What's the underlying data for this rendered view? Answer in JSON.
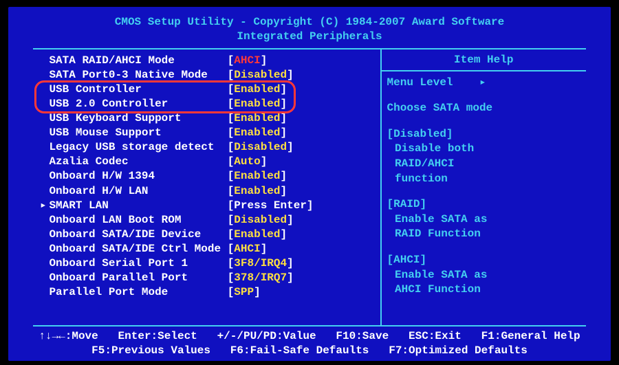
{
  "header": {
    "line1": "CMOS Setup Utility - Copyright (C) 1984-2007 Award Software",
    "line2": "Integrated Peripherals"
  },
  "labelWidth": 27,
  "settings": [
    {
      "label": "SATA RAID/AHCI Mode",
      "value": "AHCI",
      "valueColor": "red",
      "marker": ""
    },
    {
      "label": "SATA Port0-3 Native Mode",
      "value": "Disabled",
      "valueColor": "yellow",
      "marker": ""
    },
    {
      "label": "USB Controller",
      "value": "Enabled",
      "valueColor": "yellow",
      "marker": "",
      "highlight": true
    },
    {
      "label": "USB 2.0 Controller",
      "value": "Enabled",
      "valueColor": "yellow",
      "marker": "",
      "highlight": true
    },
    {
      "label": "USB Keyboard Support",
      "value": "Enabled",
      "valueColor": "yellow",
      "marker": ""
    },
    {
      "label": "USB Mouse Support",
      "value": "Enabled",
      "valueColor": "yellow",
      "marker": ""
    },
    {
      "label": "Legacy USB storage detect",
      "value": "Disabled",
      "valueColor": "yellow",
      "marker": ""
    },
    {
      "label": "Azalia Codec",
      "value": "Auto",
      "valueColor": "yellow",
      "marker": ""
    },
    {
      "label": "Onboard H/W 1394",
      "value": "Enabled",
      "valueColor": "yellow",
      "marker": ""
    },
    {
      "label": "Onboard H/W LAN",
      "value": "Enabled",
      "valueColor": "yellow",
      "marker": ""
    },
    {
      "label": "SMART LAN",
      "value": "Press Enter",
      "valueColor": "white",
      "marker": "▸"
    },
    {
      "label": "Onboard LAN Boot ROM",
      "value": "Disabled",
      "valueColor": "yellow",
      "marker": ""
    },
    {
      "label": "Onboard SATA/IDE Device",
      "value": "Enabled",
      "valueColor": "yellow",
      "marker": ""
    },
    {
      "label": "Onboard SATA/IDE Ctrl Mode",
      "value": "AHCI",
      "valueColor": "yellow",
      "marker": ""
    },
    {
      "label": "Onboard Serial Port 1",
      "value": "3F8/IRQ4",
      "valueColor": "yellow",
      "marker": ""
    },
    {
      "label": "Onboard Parallel Port",
      "value": "378/IRQ7",
      "valueColor": "yellow",
      "marker": ""
    },
    {
      "label": "Parallel Port Mode",
      "value": "SPP",
      "valueColor": "yellow",
      "marker": ""
    }
  ],
  "help": {
    "title": "Item Help",
    "menuLevel": "Menu Level    ▸",
    "description": "Choose SATA mode",
    "blocks": [
      {
        "head": "[Disabled]",
        "lines": [
          "Disable both",
          "RAID/AHCI",
          "function"
        ]
      },
      {
        "head": "[RAID]",
        "lines": [
          "Enable SATA as",
          "RAID Function"
        ]
      },
      {
        "head": "[AHCI]",
        "lines": [
          "Enable SATA as",
          "AHCI Function"
        ]
      }
    ]
  },
  "footer": {
    "line1": "↑↓→←:Move   Enter:Select   +/-/PU/PD:Value   F10:Save   ESC:Exit   F1:General Help",
    "line2": "F5:Previous Values   F6:Fail-Safe Defaults   F7:Optimized Defaults"
  }
}
